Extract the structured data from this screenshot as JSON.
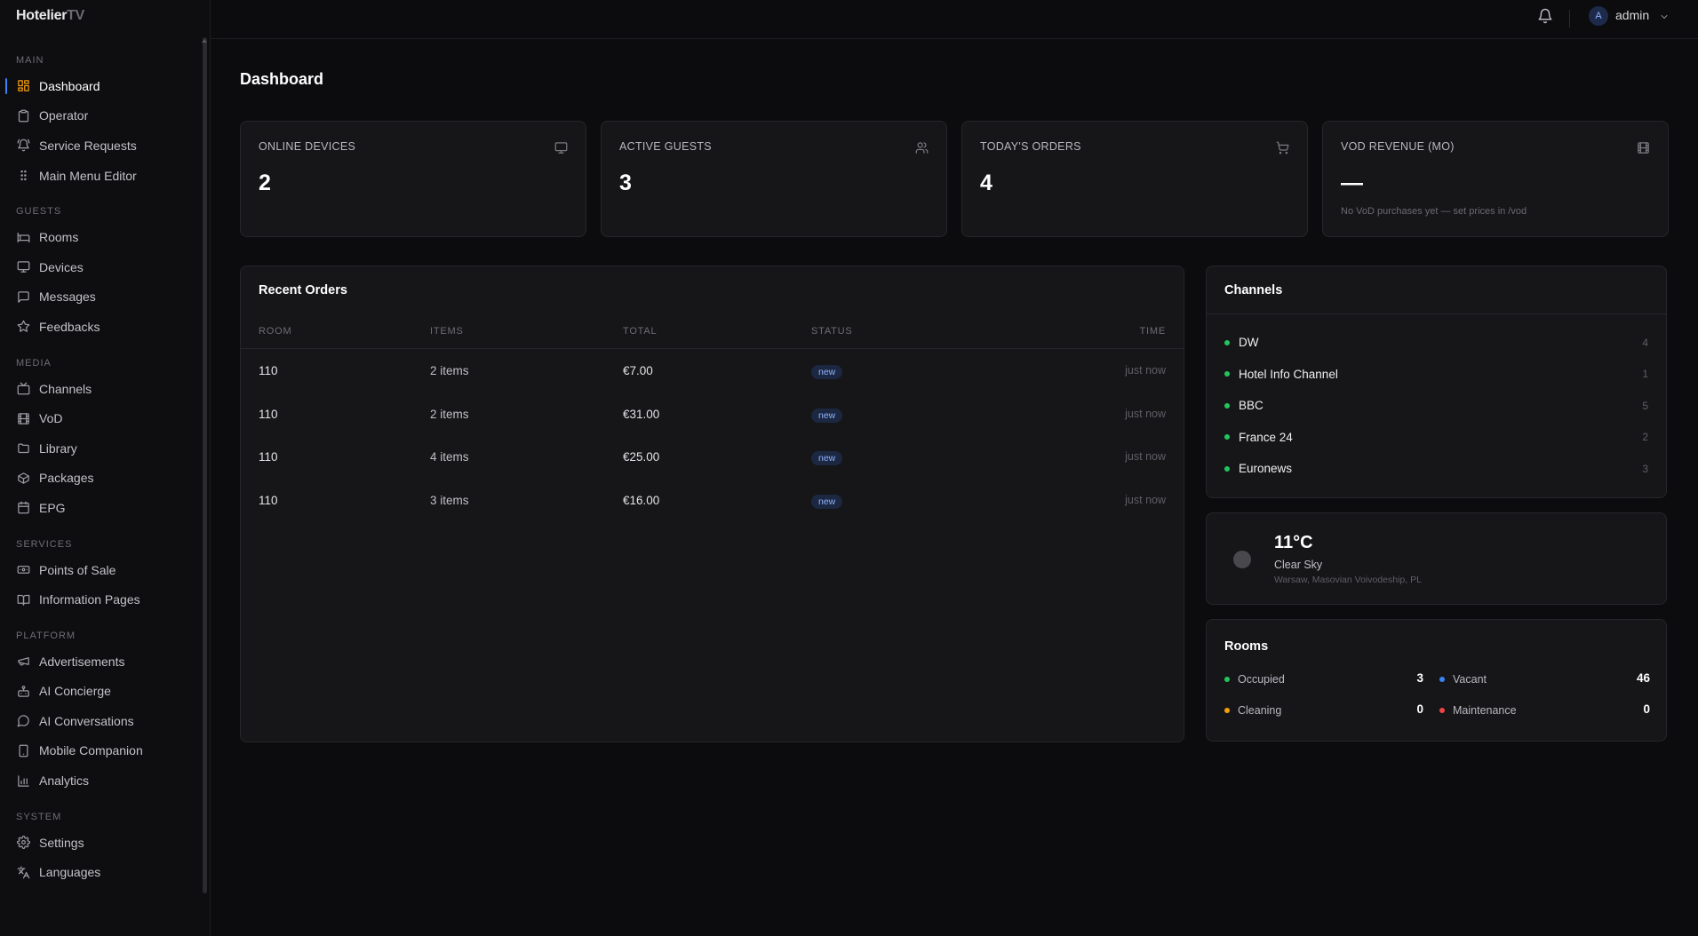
{
  "brand": {
    "name": "Hotelier",
    "suffix": "TV"
  },
  "sidebar": {
    "sections": [
      {
        "title": "MAIN",
        "items": [
          {
            "label": "Dashboard",
            "icon": "grid-icon",
            "active": true
          },
          {
            "label": "Operator",
            "icon": "clipboard-icon"
          },
          {
            "label": "Service Requests",
            "icon": "bell-ring-icon"
          },
          {
            "label": "Main Menu Editor",
            "icon": "grip-icon"
          }
        ]
      },
      {
        "title": "GUESTS",
        "items": [
          {
            "label": "Rooms",
            "icon": "bed-icon"
          },
          {
            "label": "Devices",
            "icon": "monitor-icon"
          },
          {
            "label": "Messages",
            "icon": "message-icon"
          },
          {
            "label": "Feedbacks",
            "icon": "star-icon"
          }
        ]
      },
      {
        "title": "MEDIA",
        "items": [
          {
            "label": "Channels",
            "icon": "tv-icon"
          },
          {
            "label": "VoD",
            "icon": "film-icon"
          },
          {
            "label": "Library",
            "icon": "folder-icon"
          },
          {
            "label": "Packages",
            "icon": "package-icon"
          },
          {
            "label": "EPG",
            "icon": "calendar-icon"
          }
        ]
      },
      {
        "title": "SERVICES",
        "items": [
          {
            "label": "Points of Sale",
            "icon": "banknote-icon"
          },
          {
            "label": "Information Pages",
            "icon": "book-icon"
          }
        ]
      },
      {
        "title": "PLATFORM",
        "items": [
          {
            "label": "Advertisements",
            "icon": "megaphone-icon"
          },
          {
            "label": "AI Concierge",
            "icon": "bot-icon"
          },
          {
            "label": "AI Conversations",
            "icon": "chat-icon"
          },
          {
            "label": "Mobile Companion",
            "icon": "smartphone-icon"
          },
          {
            "label": "Analytics",
            "icon": "bar-chart-icon"
          }
        ]
      },
      {
        "title": "SYSTEM",
        "items": [
          {
            "label": "Settings",
            "icon": "gear-icon"
          },
          {
            "label": "Languages",
            "icon": "translate-icon"
          }
        ]
      }
    ]
  },
  "topbar": {
    "user_initial": "A",
    "user_name": "admin"
  },
  "page": {
    "title": "Dashboard"
  },
  "stats": [
    {
      "label": "ONLINE DEVICES",
      "value": "2",
      "icon": "monitor-icon"
    },
    {
      "label": "ACTIVE GUESTS",
      "value": "3",
      "icon": "users-icon"
    },
    {
      "label": "TODAY'S ORDERS",
      "value": "4",
      "icon": "cart-icon"
    },
    {
      "label": "VOD REVENUE (MO)",
      "value": "—",
      "icon": "film-icon",
      "sub": "No VoD purchases yet — set prices in /vod"
    }
  ],
  "orders": {
    "title": "Recent Orders",
    "columns": [
      "ROOM",
      "ITEMS",
      "TOTAL",
      "STATUS",
      "TIME"
    ],
    "rows": [
      {
        "room": "110",
        "items": "2 items",
        "total": "€7.00",
        "status": "new",
        "time": "just now"
      },
      {
        "room": "110",
        "items": "2 items",
        "total": "€31.00",
        "status": "new",
        "time": "just now"
      },
      {
        "room": "110",
        "items": "4 items",
        "total": "€25.00",
        "status": "new",
        "time": "just now"
      },
      {
        "room": "110",
        "items": "3 items",
        "total": "€16.00",
        "status": "new",
        "time": "just now"
      }
    ]
  },
  "channels": {
    "title": "Channels",
    "items": [
      {
        "name": "DW",
        "count": "4"
      },
      {
        "name": "Hotel Info Channel",
        "count": "1"
      },
      {
        "name": "BBC",
        "count": "5"
      },
      {
        "name": "France 24",
        "count": "2"
      },
      {
        "name": "Euronews",
        "count": "3"
      }
    ]
  },
  "weather": {
    "temp": "11°C",
    "desc": "Clear Sky",
    "location": "Warsaw, Masovian Voivodeship, PL"
  },
  "rooms": {
    "title": "Rooms",
    "stats": [
      {
        "label": "Occupied",
        "value": "3",
        "color": "#22c55e"
      },
      {
        "label": "Vacant",
        "value": "46",
        "color": "#3b82f6"
      },
      {
        "label": "Cleaning",
        "value": "0",
        "color": "#f59e0b"
      },
      {
        "label": "Maintenance",
        "value": "0",
        "color": "#ef4444"
      }
    ]
  },
  "colors": {
    "accent": "#3b82f6",
    "active_icon": "#f59e0b",
    "online": "#22c55e"
  }
}
